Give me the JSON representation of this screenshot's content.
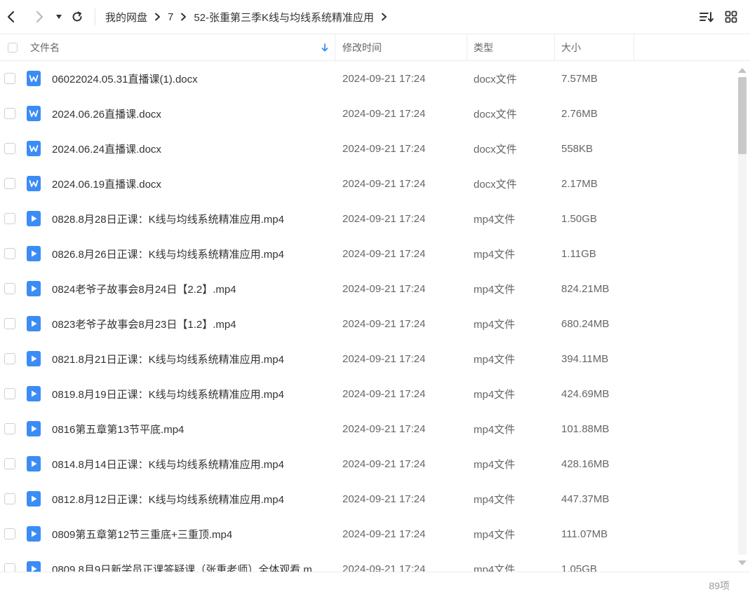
{
  "nav": {
    "back_icon": "chevron-left-icon",
    "forward_icon": "chevron-right-icon",
    "history_icon": "caret-down-icon",
    "refresh_icon": "refresh-icon"
  },
  "breadcrumb": [
    "我的网盘",
    "7",
    "52-张重第三季K线与均线系统精准应用"
  ],
  "toolbar": {
    "sort_icon": "sort-list-icon",
    "view_icon": "grid-view-icon"
  },
  "columns": {
    "name": "文件名",
    "modified": "修改时间",
    "type": "类型",
    "size": "大小"
  },
  "colors": {
    "accent": "#3b8cf5",
    "text": "#333333",
    "muted": "#666666"
  },
  "files": [
    {
      "name": "06022024.05.31直播课(1).docx",
      "modified": "2024-09-21 17:24",
      "type": "docx文件",
      "size": "7.57MB",
      "icon": "word-doc-icon"
    },
    {
      "name": "2024.06.26直播课.docx",
      "modified": "2024-09-21 17:24",
      "type": "docx文件",
      "size": "2.76MB",
      "icon": "word-doc-icon"
    },
    {
      "name": "2024.06.24直播课.docx",
      "modified": "2024-09-21 17:24",
      "type": "docx文件",
      "size": "558KB",
      "icon": "word-doc-icon"
    },
    {
      "name": "2024.06.19直播课.docx",
      "modified": "2024-09-21 17:24",
      "type": "docx文件",
      "size": "2.17MB",
      "icon": "word-doc-icon"
    },
    {
      "name": "0828.8月28日正课：K线与均线系统精准应用.mp4",
      "modified": "2024-09-21 17:24",
      "type": "mp4文件",
      "size": "1.50GB",
      "icon": "video-play-icon"
    },
    {
      "name": "0826.8月26日正课：K线与均线系统精准应用.mp4",
      "modified": "2024-09-21 17:24",
      "type": "mp4文件",
      "size": "1.11GB",
      "icon": "video-play-icon"
    },
    {
      "name": "0824老爷子故事会8月24日【2.2】.mp4",
      "modified": "2024-09-21 17:24",
      "type": "mp4文件",
      "size": "824.21MB",
      "icon": "video-play-icon"
    },
    {
      "name": "0823老爷子故事会8月23日【1.2】.mp4",
      "modified": "2024-09-21 17:24",
      "type": "mp4文件",
      "size": "680.24MB",
      "icon": "video-play-icon"
    },
    {
      "name": "0821.8月21日正课：K线与均线系统精准应用.mp4",
      "modified": "2024-09-21 17:24",
      "type": "mp4文件",
      "size": "394.11MB",
      "icon": "video-play-icon"
    },
    {
      "name": "0819.8月19日正课：K线与均线系统精准应用.mp4",
      "modified": "2024-09-21 17:24",
      "type": "mp4文件",
      "size": "424.69MB",
      "icon": "video-play-icon"
    },
    {
      "name": "0816第五章第13节平底.mp4",
      "modified": "2024-09-21 17:24",
      "type": "mp4文件",
      "size": "101.88MB",
      "icon": "video-play-icon"
    },
    {
      "name": "0814.8月14日正课：K线与均线系统精准应用.mp4",
      "modified": "2024-09-21 17:24",
      "type": "mp4文件",
      "size": "428.16MB",
      "icon": "video-play-icon"
    },
    {
      "name": "0812.8月12日正课：K线与均线系统精准应用.mp4",
      "modified": "2024-09-21 17:24",
      "type": "mp4文件",
      "size": "447.37MB",
      "icon": "video-play-icon"
    },
    {
      "name": "0809第五章第12节三重底+三重顶.mp4",
      "modified": "2024-09-21 17:24",
      "type": "mp4文件",
      "size": "111.07MB",
      "icon": "video-play-icon"
    },
    {
      "name": "0809.8月9日新学员正课答疑课（张重老师）全体观看.m",
      "modified": "2024-09-21 17:24",
      "type": "mp4文件",
      "size": "1.05GB",
      "icon": "video-play-icon"
    }
  ],
  "footer": {
    "count": "89项"
  }
}
